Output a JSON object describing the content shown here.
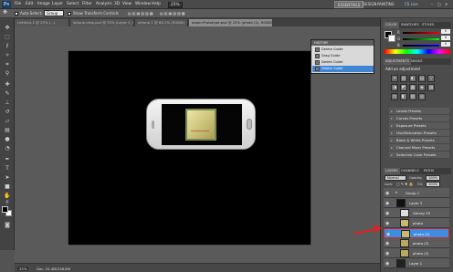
{
  "menubar": {
    "app_icon": "Ps",
    "items": [
      "File",
      "Edit",
      "Image",
      "Layer",
      "Select",
      "Filter",
      "Analysis",
      "3D",
      "View",
      "Window",
      "Help"
    ],
    "zoom": "25%",
    "workspaces": {
      "essentials": "ESSENTIALS",
      "design": "DESIGN",
      "painting": "PAINTING"
    },
    "cslive": "CS Live"
  },
  "options": {
    "auto_select_label": "Auto-Select:",
    "auto_select_value": "Group",
    "show_transform_label": "Show Transform Controls"
  },
  "doctabs": [
    {
      "label": "Untitled-1 @ 25% (...)",
      "active": false
    },
    {
      "label": "iphone-drop.psd @ 33% (Layer 5, RGB/8)",
      "active": false
    },
    {
      "label": "iphone-1 @ 66.7% (RGB/8)",
      "active": false
    },
    {
      "label": "paper-Prototype.psd @ 25% (photo (2), RGB/8) *",
      "active": true
    }
  ],
  "status": {
    "zoom": "25%",
    "doc": "Doc: 24.4M/158.8M"
  },
  "history": {
    "title": "HISTORY",
    "rows": [
      {
        "label": "Delete Guide",
        "active": false
      },
      {
        "label": "Drag Guide",
        "active": false
      },
      {
        "label": "Delete Guide",
        "active": false
      },
      {
        "label": "Delete Guide",
        "active": true
      }
    ]
  },
  "color_panel": {
    "tabs": [
      "COLOR",
      "SWATCHES",
      "STYLES"
    ],
    "channels": [
      {
        "label": "R",
        "value": "0",
        "gradient": "#ff0000"
      },
      {
        "label": "G",
        "value": "0",
        "gradient": "#00ff00"
      },
      {
        "label": "B",
        "value": "0",
        "gradient": "#0000ff"
      }
    ]
  },
  "adjustments": {
    "tabs": [
      "ADJUSTMENTS",
      "MASKS"
    ],
    "heading": "Add an adjustment",
    "icons": [
      "☀",
      "▥",
      "◐",
      "▤",
      "▽",
      "◑",
      "◩",
      "▦",
      "◈",
      "▨",
      "⚖",
      "◧",
      "▧",
      "◎"
    ],
    "presets": [
      "Levels Presets",
      "Curves Presets",
      "Exposure Presets",
      "Hue/Saturation Presets",
      "Black & White Presets",
      "Channel Mixer Presets",
      "Selective Color Presets"
    ]
  },
  "layers": {
    "tabs": [
      "LAYERS",
      "CHANNELS",
      "PATHS"
    ],
    "blend_mode": "Normal",
    "opacity_label": "Opacity:",
    "opacity": "100%",
    "fill_label": "Fill:",
    "fill": "100%",
    "lock_label": "Lock:",
    "items": [
      {
        "name": "Group 1",
        "selected": false,
        "thumb": "#444"
      },
      {
        "name": "Layer 3",
        "selected": false,
        "thumb": "#111"
      },
      {
        "name": "Galaxy S3",
        "selected": false,
        "thumb": "#ddd"
      },
      {
        "name": "photo",
        "selected": false,
        "thumb": "#c9b870"
      },
      {
        "name": "photo (2)",
        "selected": true,
        "thumb": "#c9b870"
      },
      {
        "name": "photo (2)",
        "selected": false,
        "thumb": "#b8a860"
      },
      {
        "name": "photo (2)",
        "selected": false,
        "thumb": "#b8a860"
      },
      {
        "name": "Layer 1",
        "selected": false,
        "thumb": "#222"
      }
    ]
  },
  "colors": {
    "selected": "#3b8ee0",
    "arrow": "#e02020",
    "accent": "#3f85d4"
  },
  "icons": {
    "move": "move-icon",
    "marquee": "marquee-icon",
    "lasso": "lasso-icon",
    "wand": "magic-wand-icon",
    "crop": "crop-icon",
    "eyedropper": "eyedropper-icon",
    "heal": "healing-brush-icon",
    "brush": "brush-icon",
    "stamp": "clone-stamp-icon",
    "history_brush": "history-brush-icon",
    "eraser": "eraser-icon",
    "gradient": "gradient-icon",
    "blur": "blur-icon",
    "dodge": "dodge-icon",
    "pen": "pen-icon",
    "type": "type-icon",
    "path": "path-select-icon",
    "shape": "shape-icon",
    "hand": "hand-icon",
    "zoom": "zoom-icon"
  }
}
